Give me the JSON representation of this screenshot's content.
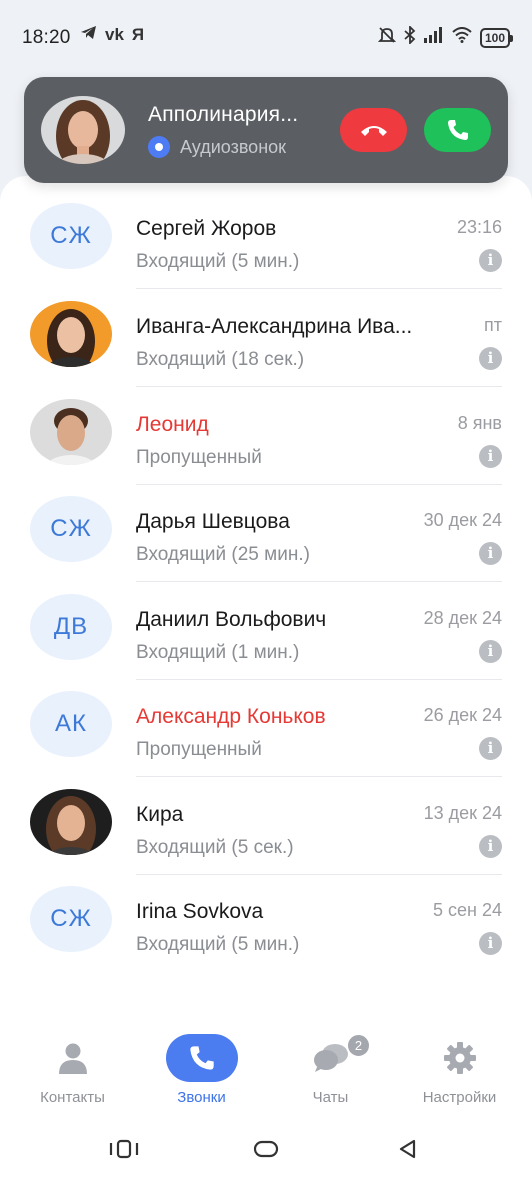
{
  "status_bar": {
    "time": "18:20",
    "app_icons": [
      "telegram-icon",
      "vk-icon",
      "yandex-icon"
    ],
    "vk_label": "vk",
    "yandex_label": "Я",
    "right_icons": [
      "mute-icon",
      "bluetooth-icon",
      "signal-icon",
      "wifi-icon"
    ],
    "battery": "100"
  },
  "incoming_call": {
    "name": "Апполинария...",
    "type": "Аудиозвонок",
    "decline_icon": "decline-call-icon",
    "accept_icon": "accept-call-icon",
    "decline_color": "#ef3a3f",
    "accept_color": "#1ec15a"
  },
  "calls": [
    {
      "initials": "СЖ",
      "name": "Сергей Жоров",
      "sub": "Входящий (5 мин.)",
      "date": "23:16",
      "missed": false,
      "avatar": "initials"
    },
    {
      "initials": "",
      "name": "Иванга-Александрина Ива...",
      "sub": "Входящий (18 сек.)",
      "date": "пт",
      "missed": false,
      "avatar": "photo-woman-orange"
    },
    {
      "initials": "",
      "name": "Леонид",
      "sub": "Пропущенный",
      "date": "8 янв",
      "missed": true,
      "avatar": "photo-man-gray"
    },
    {
      "initials": "СЖ",
      "name": "Дарья Шевцова",
      "sub": "Входящий (25 мин.)",
      "date": "30 дек 24",
      "missed": false,
      "avatar": "initials"
    },
    {
      "initials": "ДВ",
      "name": "Даниил Вольфович",
      "sub": "Входящий (1 мин.)",
      "date": "28 дек 24",
      "missed": false,
      "avatar": "initials"
    },
    {
      "initials": "АК",
      "name": "Александр Коньков",
      "sub": "Пропущенный",
      "date": "26 дек 24",
      "missed": true,
      "avatar": "initials"
    },
    {
      "initials": "",
      "name": "Кира",
      "sub": "Входящий (5 сек.)",
      "date": "13 дек 24",
      "missed": false,
      "avatar": "photo-woman-dark"
    },
    {
      "initials": "СЖ",
      "name": "Irina Sovkova",
      "sub": "Входящий (5 мин.)",
      "date": "5 сен 24",
      "missed": false,
      "avatar": "initials"
    }
  ],
  "info_glyph": "i",
  "nav": {
    "contacts": "Контакты",
    "calls": "Звонки",
    "chats": "Чаты",
    "chats_badge": "2",
    "settings": "Настройки",
    "active": "calls",
    "accent": "#4b7cf0"
  },
  "colors": {
    "missed": "#e53935",
    "initials_bg": "#e9f1fd",
    "initials_text": "#3d7ad8"
  }
}
